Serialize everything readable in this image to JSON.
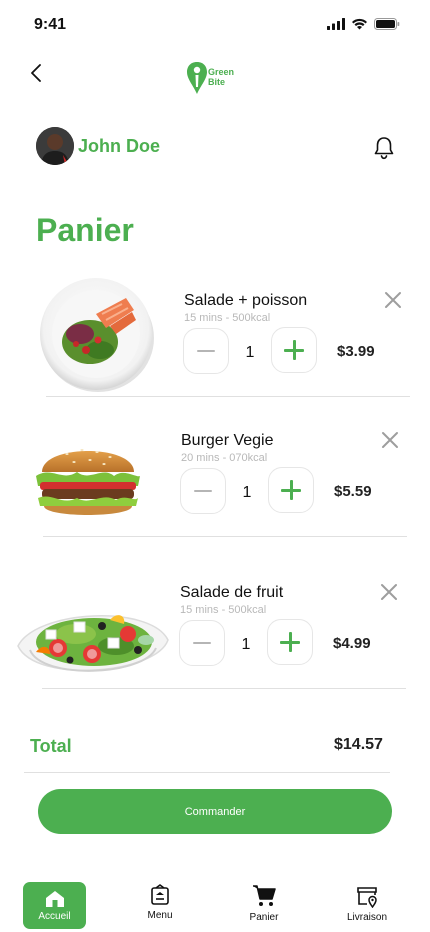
{
  "status_bar": {
    "time": "9:41"
  },
  "brand": {
    "line1": "Green",
    "line2": "Bite",
    "color": "#4caf50"
  },
  "user": {
    "name": "John Doe"
  },
  "page_title": "Panier",
  "items": [
    {
      "name": "Salade + poisson",
      "meta": "15 mins - 500kcal",
      "qty": "1",
      "price": "$3.99"
    },
    {
      "name": "Burger Vegie",
      "meta": "20 mins - 070kcal",
      "qty": "1",
      "price": "$5.59"
    },
    {
      "name": "Salade de fruit",
      "meta": "15 mins - 500kcal",
      "qty": "1",
      "price": "$4.99"
    }
  ],
  "total": {
    "label": "Total",
    "value": "$14.57"
  },
  "order_button": "Commander",
  "nav": [
    {
      "label": "Accueil",
      "icon": "home-icon",
      "active": true
    },
    {
      "label": "Menu",
      "icon": "menu-icon",
      "active": false
    },
    {
      "label": "Panier",
      "icon": "cart-icon",
      "active": false
    },
    {
      "label": "Livraison",
      "icon": "delivery-icon",
      "active": false
    }
  ],
  "colors": {
    "accent": "#4caf50",
    "text": "#1a1a1a",
    "muted": "#b8b8b8"
  }
}
